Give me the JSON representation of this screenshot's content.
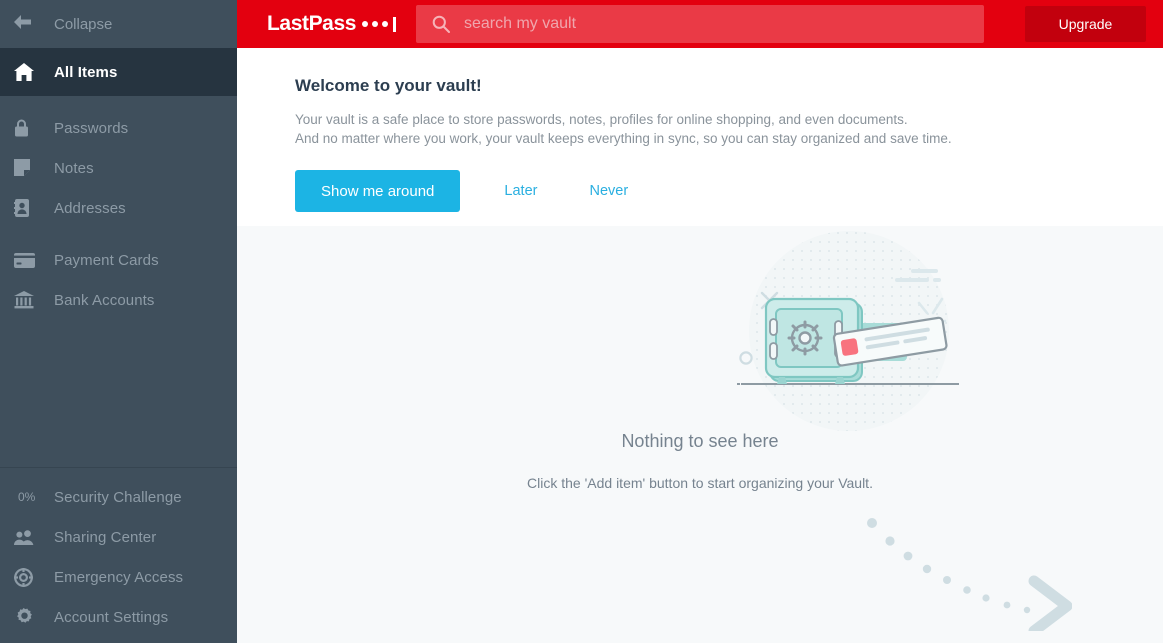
{
  "sidebar": {
    "collapse": {
      "label": "Collapse",
      "icon": "arrow-left-icon"
    },
    "primary": [
      {
        "label": "All Items",
        "icon": "home-icon",
        "active": true
      }
    ],
    "types": [
      {
        "label": "Passwords",
        "icon": "lock-icon"
      },
      {
        "label": "Notes",
        "icon": "note-icon"
      },
      {
        "label": "Addresses",
        "icon": "address-card-icon"
      }
    ],
    "financial": [
      {
        "label": "Payment Cards",
        "icon": "credit-card-icon"
      },
      {
        "label": "Bank Accounts",
        "icon": "bank-icon"
      }
    ],
    "tools": [
      {
        "label": "Security Challenge",
        "icon": "percent-badge",
        "badge": "0%"
      },
      {
        "label": "Sharing Center",
        "icon": "users-icon"
      },
      {
        "label": "Emergency Access",
        "icon": "lifebuoy-icon"
      },
      {
        "label": "Account Settings",
        "icon": "gear-icon"
      }
    ]
  },
  "header": {
    "logo_text": "LastPass",
    "logo_dots": 3,
    "search": {
      "placeholder": "search my vault",
      "value": "",
      "icon": "search-icon"
    },
    "upgrade_label": "Upgrade"
  },
  "banner": {
    "title": "Welcome to your vault!",
    "line1": "Your vault is a safe place to store passwords, notes, profiles for online shopping, and even documents.",
    "line2": "And no matter where you work, your vault keeps everything in sync, so you can stay organized and save time.",
    "tour_label": "Show me around",
    "later_label": "Later",
    "never_label": "Never"
  },
  "empty_state": {
    "illustration": "safe-with-card-illustration",
    "title": "Nothing to see here",
    "subtitle": "Click the 'Add item' button to start organizing your Vault.",
    "arrow": "dotted-arrow-pointer"
  },
  "colors": {
    "brand_red": "#e3000f",
    "upgrade_red": "#c2000d",
    "search_red": "#ea3a46",
    "sidebar": "#3f4f5c",
    "sidebar_active": "#263440",
    "accent_blue": "#1cb4e4",
    "content_bg": "#f7f9fa",
    "teal": "#9fd8d4"
  }
}
